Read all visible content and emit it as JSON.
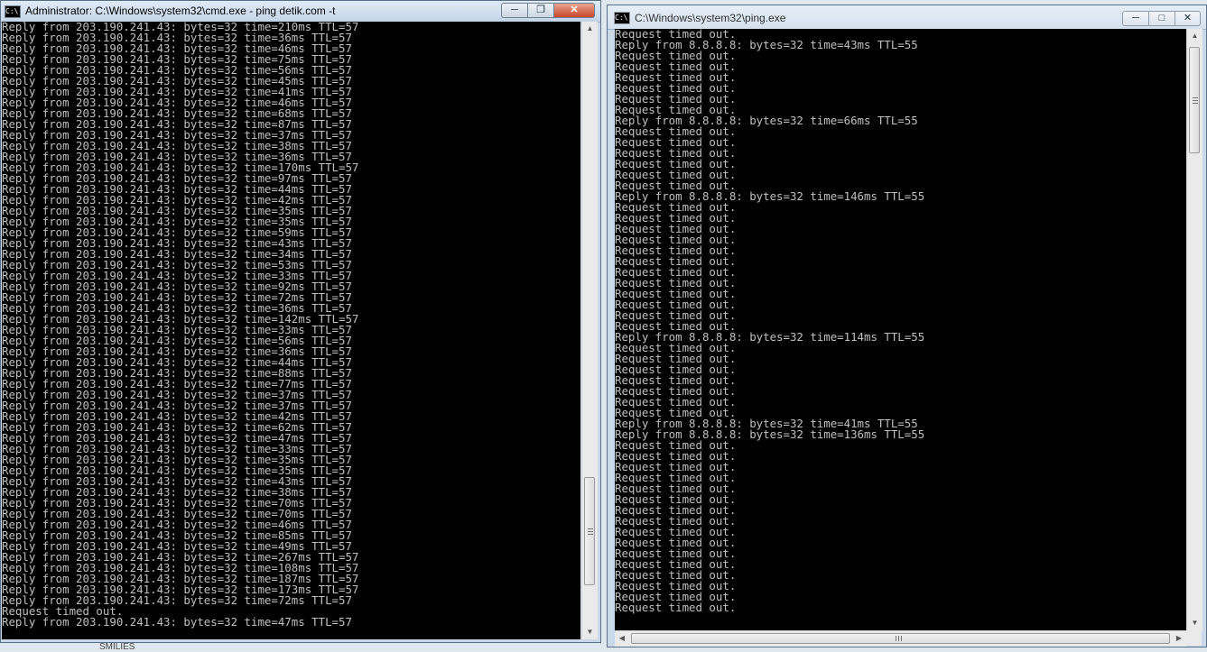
{
  "windows": {
    "left": {
      "title": "Administrator: C:\\Windows\\system32\\cmd.exe - ping  detik.com -t",
      "icon_label": "C:\\",
      "lines": [
        "Reply from 203.190.241.43: bytes=32 time=210ms TTL=57",
        "Reply from 203.190.241.43: bytes=32 time=36ms TTL=57",
        "Reply from 203.190.241.43: bytes=32 time=46ms TTL=57",
        "Reply from 203.190.241.43: bytes=32 time=75ms TTL=57",
        "Reply from 203.190.241.43: bytes=32 time=56ms TTL=57",
        "Reply from 203.190.241.43: bytes=32 time=45ms TTL=57",
        "Reply from 203.190.241.43: bytes=32 time=41ms TTL=57",
        "Reply from 203.190.241.43: bytes=32 time=46ms TTL=57",
        "Reply from 203.190.241.43: bytes=32 time=68ms TTL=57",
        "Reply from 203.190.241.43: bytes=32 time=87ms TTL=57",
        "Reply from 203.190.241.43: bytes=32 time=37ms TTL=57",
        "Reply from 203.190.241.43: bytes=32 time=38ms TTL=57",
        "Reply from 203.190.241.43: bytes=32 time=36ms TTL=57",
        "Reply from 203.190.241.43: bytes=32 time=170ms TTL=57",
        "Reply from 203.190.241.43: bytes=32 time=97ms TTL=57",
        "Reply from 203.190.241.43: bytes=32 time=44ms TTL=57",
        "Reply from 203.190.241.43: bytes=32 time=42ms TTL=57",
        "Reply from 203.190.241.43: bytes=32 time=35ms TTL=57",
        "Reply from 203.190.241.43: bytes=32 time=35ms TTL=57",
        "Reply from 203.190.241.43: bytes=32 time=59ms TTL=57",
        "Reply from 203.190.241.43: bytes=32 time=43ms TTL=57",
        "Reply from 203.190.241.43: bytes=32 time=34ms TTL=57",
        "Reply from 203.190.241.43: bytes=32 time=53ms TTL=57",
        "Reply from 203.190.241.43: bytes=32 time=33ms TTL=57",
        "Reply from 203.190.241.43: bytes=32 time=92ms TTL=57",
        "Reply from 203.190.241.43: bytes=32 time=72ms TTL=57",
        "Reply from 203.190.241.43: bytes=32 time=36ms TTL=57",
        "Reply from 203.190.241.43: bytes=32 time=142ms TTL=57",
        "Reply from 203.190.241.43: bytes=32 time=33ms TTL=57",
        "Reply from 203.190.241.43: bytes=32 time=56ms TTL=57",
        "Reply from 203.190.241.43: bytes=32 time=36ms TTL=57",
        "Reply from 203.190.241.43: bytes=32 time=44ms TTL=57",
        "Reply from 203.190.241.43: bytes=32 time=88ms TTL=57",
        "Reply from 203.190.241.43: bytes=32 time=77ms TTL=57",
        "Reply from 203.190.241.43: bytes=32 time=37ms TTL=57",
        "Reply from 203.190.241.43: bytes=32 time=37ms TTL=57",
        "Reply from 203.190.241.43: bytes=32 time=42ms TTL=57",
        "Reply from 203.190.241.43: bytes=32 time=62ms TTL=57",
        "Reply from 203.190.241.43: bytes=32 time=47ms TTL=57",
        "Reply from 203.190.241.43: bytes=32 time=33ms TTL=57",
        "Reply from 203.190.241.43: bytes=32 time=35ms TTL=57",
        "Reply from 203.190.241.43: bytes=32 time=35ms TTL=57",
        "Reply from 203.190.241.43: bytes=32 time=43ms TTL=57",
        "Reply from 203.190.241.43: bytes=32 time=38ms TTL=57",
        "Reply from 203.190.241.43: bytes=32 time=70ms TTL=57",
        "Reply from 203.190.241.43: bytes=32 time=70ms TTL=57",
        "Reply from 203.190.241.43: bytes=32 time=46ms TTL=57",
        "Reply from 203.190.241.43: bytes=32 time=85ms TTL=57",
        "Reply from 203.190.241.43: bytes=32 time=49ms TTL=57",
        "Reply from 203.190.241.43: bytes=32 time=267ms TTL=57",
        "Reply from 203.190.241.43: bytes=32 time=108ms TTL=57",
        "Reply from 203.190.241.43: bytes=32 time=187ms TTL=57",
        "Reply from 203.190.241.43: bytes=32 time=173ms TTL=57",
        "Reply from 203.190.241.43: bytes=32 time=72ms TTL=57",
        "Request timed out.",
        "Reply from 203.190.241.43: bytes=32 time=47ms TTL=57"
      ]
    },
    "right": {
      "title": "C:\\Windows\\system32\\ping.exe",
      "icon_label": "C:\\",
      "lines": [
        "Request timed out.",
        "Reply from 8.8.8.8: bytes=32 time=43ms TTL=55",
        "Request timed out.",
        "Request timed out.",
        "Request timed out.",
        "Request timed out.",
        "Request timed out.",
        "Request timed out.",
        "Reply from 8.8.8.8: bytes=32 time=66ms TTL=55",
        "Request timed out.",
        "Request timed out.",
        "Request timed out.",
        "Request timed out.",
        "Request timed out.",
        "Request timed out.",
        "Reply from 8.8.8.8: bytes=32 time=146ms TTL=55",
        "Request timed out.",
        "Request timed out.",
        "Request timed out.",
        "Request timed out.",
        "Request timed out.",
        "Request timed out.",
        "Request timed out.",
        "Request timed out.",
        "Request timed out.",
        "Request timed out.",
        "Request timed out.",
        "Request timed out.",
        "Reply from 8.8.8.8: bytes=32 time=114ms TTL=55",
        "Request timed out.",
        "Request timed out.",
        "Request timed out.",
        "Request timed out.",
        "Request timed out.",
        "Request timed out.",
        "Request timed out.",
        "Reply from 8.8.8.8: bytes=32 time=41ms TTL=55",
        "Reply from 8.8.8.8: bytes=32 time=136ms TTL=55",
        "Request timed out.",
        "Request timed out.",
        "Request timed out.",
        "Request timed out.",
        "Request timed out.",
        "Request timed out.",
        "Request timed out.",
        "Request timed out.",
        "Request timed out.",
        "Request timed out.",
        "Request timed out.",
        "Request timed out.",
        "Request timed out.",
        "Request timed out.",
        "Request timed out.",
        "Request timed out."
      ]
    }
  },
  "background_text": "SMILIES",
  "icons": {
    "minimize": "minimize-icon",
    "maximize": "maximize-icon",
    "restore": "restore-icon",
    "close": "close-icon"
  },
  "colors": {
    "console_bg": "#000000",
    "console_fg": "#c0c0c0",
    "close_button": "#c8482c"
  }
}
